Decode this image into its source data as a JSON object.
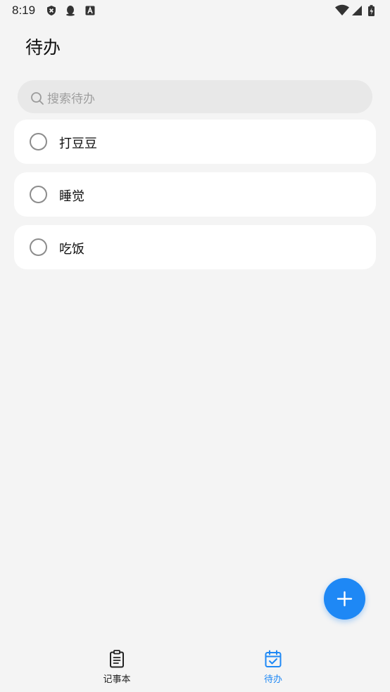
{
  "status_bar": {
    "time": "8:19",
    "icons": [
      "shield-x-icon",
      "qq-penguin-icon",
      "text-a-icon"
    ],
    "right_icons": [
      "wifi-icon",
      "signal-icon",
      "battery-charging-icon"
    ]
  },
  "header": {
    "title": "待办"
  },
  "search": {
    "placeholder": "搜索待办",
    "icon": "search-icon"
  },
  "todos": [
    {
      "label": "打豆豆",
      "done": false
    },
    {
      "label": "睡觉",
      "done": false
    },
    {
      "label": "吃饭",
      "done": false
    }
  ],
  "fab": {
    "icon": "plus-icon"
  },
  "bottom_nav": {
    "tabs": [
      {
        "label": "记事本",
        "icon": "clipboard-icon",
        "active": false
      },
      {
        "label": "待办",
        "icon": "calendar-check-icon",
        "active": true
      }
    ]
  },
  "colors": {
    "accent": "#1e88f5",
    "background": "#f4f4f4",
    "card": "#ffffff",
    "inactive_text": "#222222"
  }
}
